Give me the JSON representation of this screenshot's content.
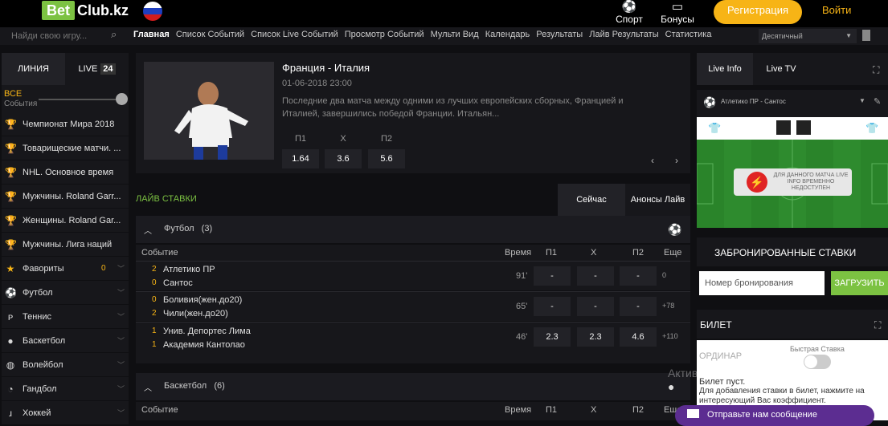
{
  "header": {
    "logo_bet": "Bet",
    "logo_club": "Club.kz",
    "nav_sport": "Спорт",
    "nav_bonuses": "Бонусы",
    "register": "Регистрация",
    "login": "Войти"
  },
  "navbar": {
    "search_placeholder": "Найди свою игру...",
    "items": [
      "Главная",
      "Список Событий",
      "Список Live Событий",
      "Просмотр Событий",
      "Мульти Вид",
      "Календарь",
      "Результаты",
      "Лайв Результаты",
      "Статистика"
    ],
    "odds_format": "Десятичный"
  },
  "sidebar": {
    "tab_line": "ЛИНИЯ",
    "tab_live": "LIVE",
    "live_count": "24",
    "all_label": "ВСЕ",
    "events_label": "События",
    "items": [
      {
        "label": "Чемпионат Мира 2018",
        "icon": "trophy-icon"
      },
      {
        "label": "Товарищеские матчи. ...",
        "icon": "trophy-icon"
      },
      {
        "label": "NHL. Основное время",
        "icon": "trophy-icon"
      },
      {
        "label": "Мужчины. Roland Garr...",
        "icon": "trophy-icon"
      },
      {
        "label": "Женщины. Roland Gar...",
        "icon": "trophy-icon"
      },
      {
        "label": "Мужчины. Лига наций",
        "icon": "trophy-icon"
      },
      {
        "label": "Фавориты",
        "icon": "star-icon",
        "count": "0"
      },
      {
        "label": "Футбол",
        "icon": "football-icon"
      },
      {
        "label": "Теннис",
        "icon": "tennis-icon"
      },
      {
        "label": "Баскетбол",
        "icon": "basketball-icon"
      },
      {
        "label": "Волейбол",
        "icon": "volleyball-icon"
      },
      {
        "label": "Гандбол",
        "icon": "handball-icon"
      },
      {
        "label": "Хоккей",
        "icon": "hockey-icon"
      }
    ]
  },
  "featured": {
    "title": "Франция - Италия",
    "date": "01-06-2018 23:00",
    "description": "Последние два матча между одними из лучших европейских сборных, Францией и Италией, завершились победой Франции. Итальян...",
    "odds_labels": [
      "П1",
      "Х",
      "П2"
    ],
    "odds": [
      "1.64",
      "3.6",
      "5.6"
    ]
  },
  "live": {
    "title": "ЛАЙВ СТАВКИ",
    "tab_now": "Сейчас",
    "tab_announce": "Анонсы Лайв",
    "football_header": "Футбол",
    "football_count": "(3)",
    "basketball_header": "Баскетбол",
    "basketball_count": "(6)",
    "columns": {
      "event": "Событие",
      "time": "Время",
      "p1": "П1",
      "x": "Х",
      "p2": "П2",
      "more": "Еще"
    },
    "matches": [
      {
        "score1": "2",
        "team1": "Атлетико ПР",
        "score2": "0",
        "team2": "Сантос",
        "time": "91'",
        "p1": "-",
        "x": "-",
        "p2": "-",
        "more": "0"
      },
      {
        "score1": "0",
        "team1": "Боливия(жен.до20)",
        "score2": "2",
        "team2": "Чили(жен.до20)",
        "time": "65'",
        "p1": "-",
        "x": "-",
        "p2": "-",
        "more": "+78"
      },
      {
        "score1": "1",
        "team1": "Унив. Депортес Лима",
        "score2": "1",
        "team2": "Академия Кантолао",
        "time": "46'",
        "p1": "2.3",
        "x": "2.3",
        "p2": "4.6",
        "more": "+110"
      }
    ]
  },
  "right_panel": {
    "tab_live_info": "Live Info",
    "tab_live_tv": "Live TV",
    "match_label": "Атлетико ПР - Сантос",
    "notice": "ДЛЯ ДАННОГО МАТЧА LIVE INFO ВРЕМЕННО НЕДОСТУПЕН",
    "booked_title": "ЗАБРОНИРОВАННЫЕ СТАВКИ",
    "booking_placeholder": "Номер бронирования",
    "load_button": "ЗАГРУЗИТЬ",
    "ticket_title": "БИЛЕТ",
    "single": "ОРДИНАР",
    "quick_bet": "Быстрая Ставка",
    "empty_ticket": "Билет пуст.",
    "empty_hint": "Для добавления ставки в билет, нажмите на интересующий Вас коэффициент.",
    "activation": "Активация Windows",
    "message_button": "Отправьте нам сообщение"
  }
}
